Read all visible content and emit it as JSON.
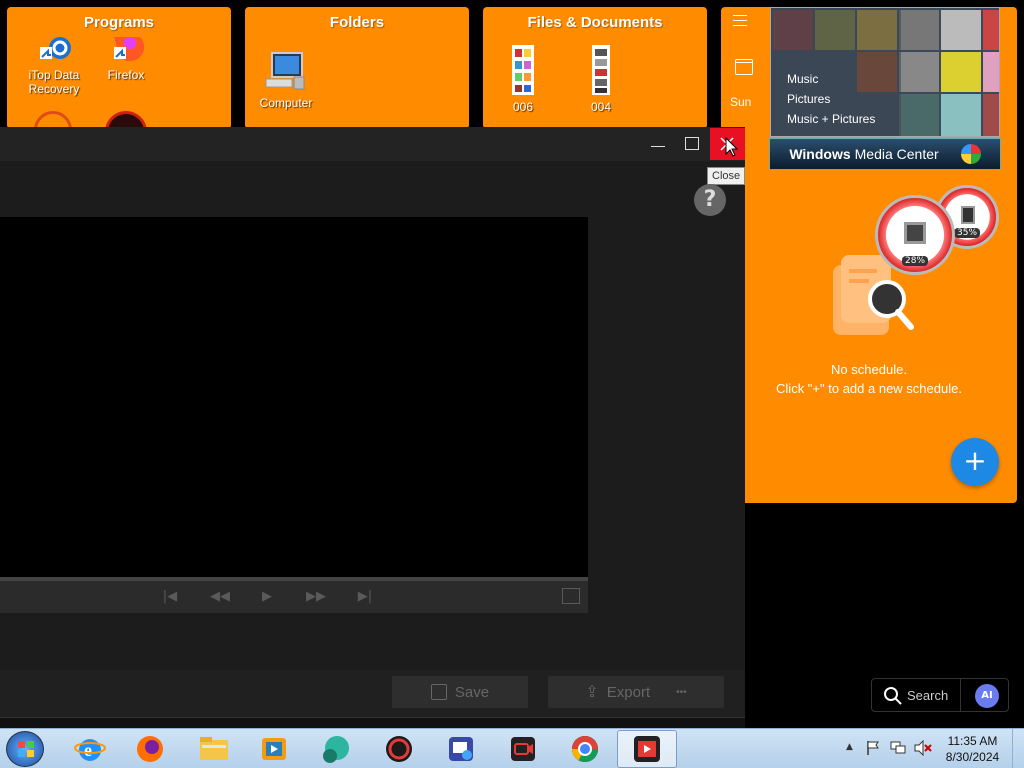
{
  "fences": {
    "programs": {
      "title": "Programs",
      "items": [
        {
          "label": "iTop Data Recovery"
        },
        {
          "label": "Firefox"
        }
      ]
    },
    "folders": {
      "title": "Folders",
      "items": [
        {
          "label": "Computer"
        }
      ]
    },
    "files": {
      "title": "Files & Documents",
      "items": [
        {
          "label": "006"
        },
        {
          "label": "004"
        }
      ]
    }
  },
  "media_center": {
    "menu": [
      "Music",
      "Pictures",
      "Music + Pictures"
    ],
    "brand_prefix": "Windows",
    "brand_suffix": "Media Center"
  },
  "gauges": {
    "cpu": "28%",
    "memory": "35%"
  },
  "scheduler": {
    "day_label": "Sun",
    "empty_line1": "No schedule.",
    "empty_line2": "Click \"+\" to add a new schedule."
  },
  "window": {
    "tooltip": "Close",
    "help": "?"
  },
  "editor": {
    "save_label": "Save",
    "export_label": "Export",
    "more_label": "•••"
  },
  "search_widget": {
    "label": "Search",
    "ai_label": "AI"
  },
  "clock": {
    "time": "11:35 AM",
    "date": "8/30/2024"
  },
  "colors": {
    "orange": "#ff8c00",
    "close_red": "#e81123",
    "fab_blue": "#1e88e5"
  }
}
